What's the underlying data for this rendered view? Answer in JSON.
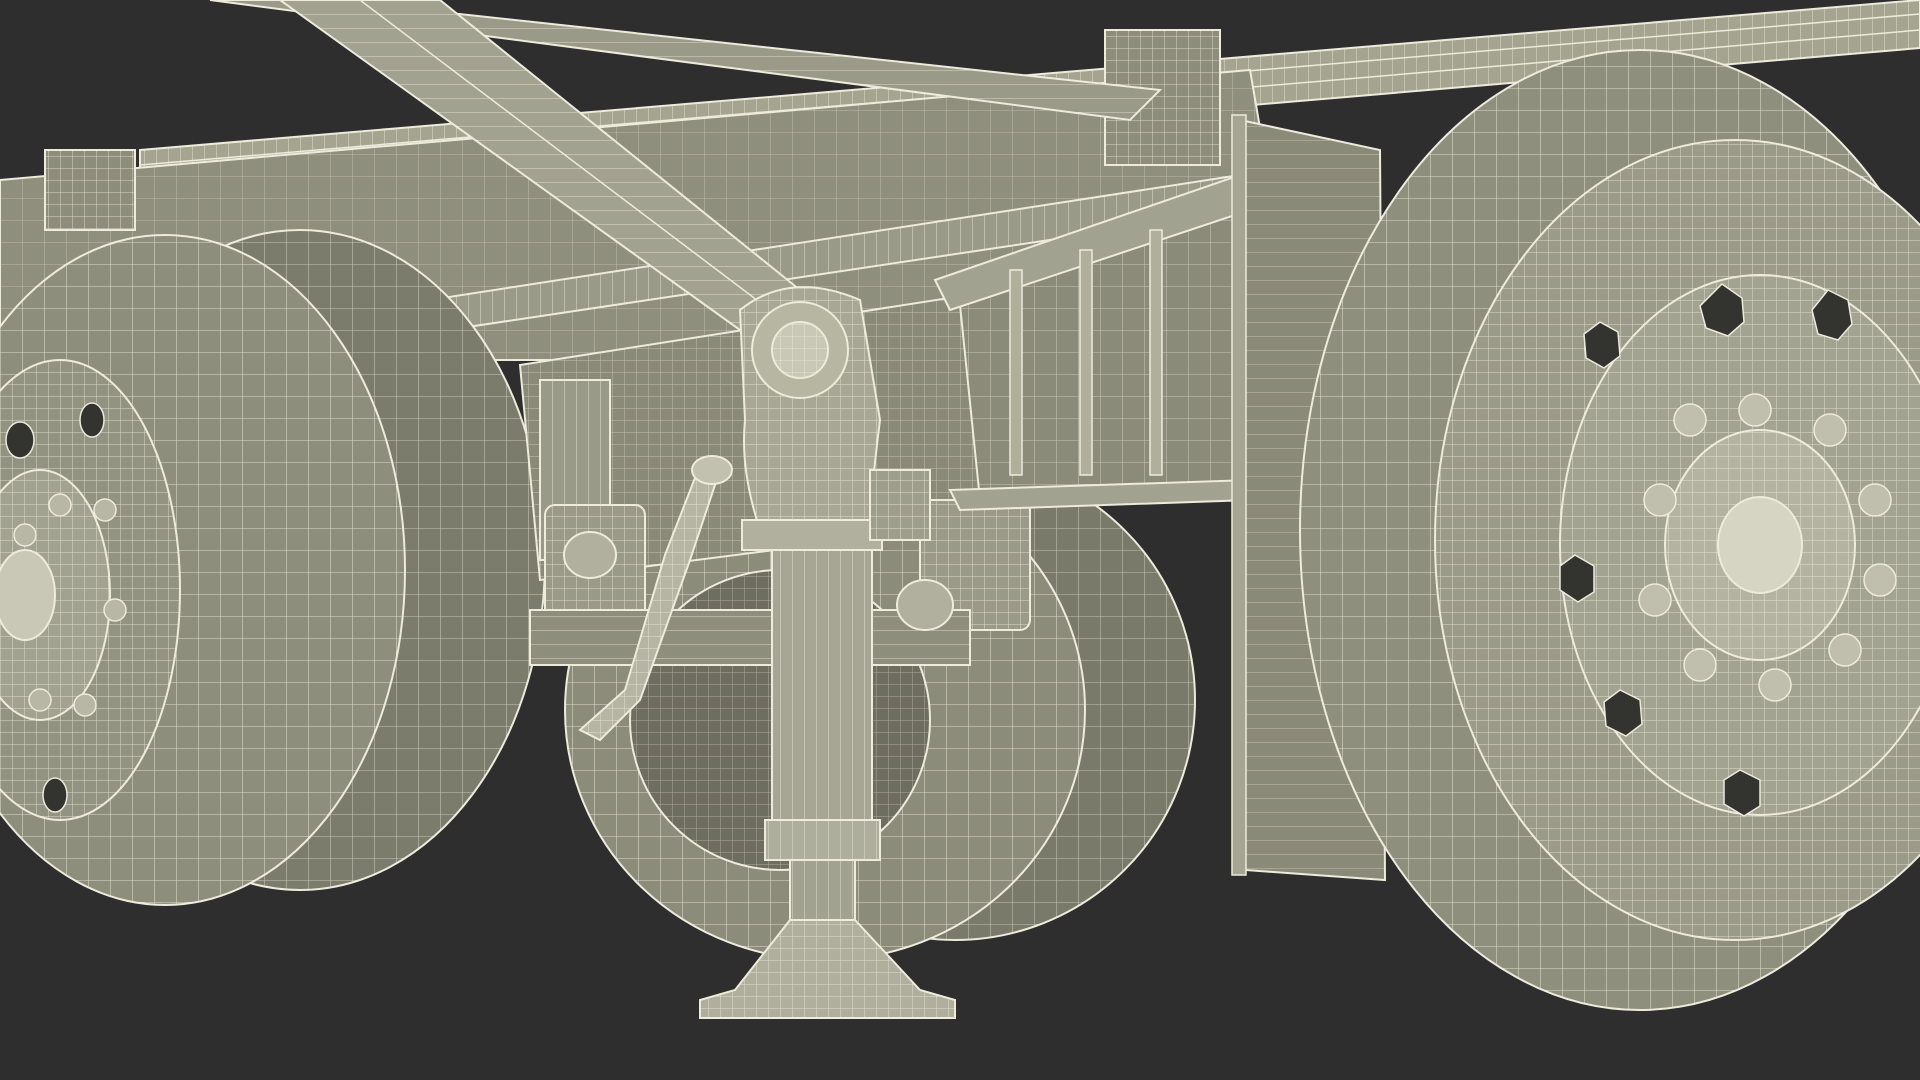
{
  "scene": {
    "background": "#2e2e2e",
    "surface_fill": "#9a9a88",
    "surface_shadow": "#7c7c6c",
    "surface_dark": "#5e5e52",
    "wire_color": "#ecebdc",
    "hole_color": "#333330"
  }
}
